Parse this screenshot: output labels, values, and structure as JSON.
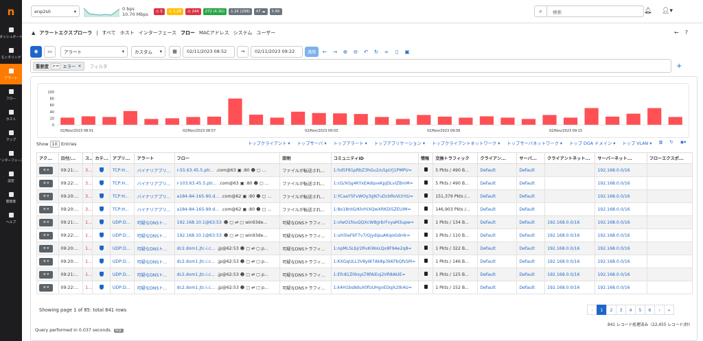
{
  "sidebar": {
    "logo": "n",
    "items": [
      {
        "label": "ダッシュボード",
        "icon": "gauge-icon"
      },
      {
        "label": "モニタリング",
        "icon": "pulse-icon"
      },
      {
        "label": "アラート",
        "icon": "warning-icon",
        "active": true
      },
      {
        "label": "フロー",
        "icon": "bars-icon"
      },
      {
        "label": "ホスト",
        "icon": "laptop-icon"
      },
      {
        "label": "マップ",
        "icon": "map-icon"
      },
      {
        "label": "インターフェース",
        "icon": "ethernet-icon"
      },
      {
        "label": "設定",
        "icon": "gear-icon"
      },
      {
        "label": "開発者",
        "icon": "code-icon"
      },
      {
        "label": "ヘルプ",
        "icon": "help-icon"
      }
    ]
  },
  "topbar": {
    "interface": "enp2s0",
    "rate_top": "0 bps",
    "rate_bottom": "10.70 Mbps",
    "badges": [
      {
        "text": "⚠ 5",
        "color": "#dc3545"
      },
      {
        "text": "⚠ 1.2K",
        "color": "#ffc107"
      },
      {
        "text": "⚠ 244",
        "color": "#dc3545"
      },
      {
        "text": "272 (4.3G)",
        "color": "#28a745"
      },
      {
        "text": "1.2K (298)",
        "color": "#6c757d"
      },
      {
        "text": "47 ☁",
        "color": "#6c757d"
      },
      {
        "text": "5.6K",
        "color": "#6c757d"
      }
    ],
    "search_placeholder": "検索"
  },
  "breadcrumbs": {
    "title": "アラートエクスプローラ",
    "items": [
      "すべて",
      "ホスト",
      "インターフェース",
      "フロー",
      "MACアドレス",
      "システム",
      "ユーザー"
    ],
    "selected": "フロー"
  },
  "filters": {
    "type": "アラート",
    "range": "カスタム",
    "start": "02/11/2023 08:52",
    "end": "02/11/2023 09:22",
    "apply": "適用"
  },
  "query": {
    "tag_key": "重要度",
    "tag_op": ">=",
    "tag_val": "エラー",
    "placeholder": "フィルタ"
  },
  "chart_data": {
    "type": "bar",
    "ylim": [
      0,
      100
    ],
    "yticks": [
      0,
      20,
      40,
      60,
      80,
      100
    ],
    "values": [
      22,
      26,
      24,
      42,
      18,
      20,
      24,
      25,
      80,
      31,
      22,
      40,
      36,
      35,
      33,
      24,
      18,
      30,
      25,
      22,
      26,
      22,
      18,
      30,
      22,
      51,
      25,
      34,
      51,
      24
    ],
    "xlabels": [
      "02/Nov/2023 08:51",
      "02/Nov/2023 08:57",
      "02/Nov/2023 09:03",
      "02/Nov/2023 09:09",
      "02/Nov/2023 09:15"
    ],
    "color": "#fe5055"
  },
  "table": {
    "show_label": "Show",
    "page_size": "10",
    "entries": "Entries",
    "dropdowns": [
      "トップクライアント",
      "トップサーバ",
      "トップアラート",
      "トップアプリケーション",
      "トップクライアントネットワーク",
      "トップサーバネットワーク",
      "トップ DGA ドメイン",
      "トップ VLAN"
    ],
    "columns": [
      "アク...",
      "日付/...",
      "ス...",
      "カテ...",
      "アプリ...",
      "アラート",
      "フロー",
      "説明",
      "コミュニティID",
      "情報",
      "交換トラフィック",
      "クライアン...",
      "サーバ...",
      "クライアントネット...",
      "サーバーネット...",
      "フローエクスポ..."
    ],
    "rows": [
      {
        "date": "09:21:...",
        "score": "3...",
        "app": "TCP:H...",
        "alert": "バイナリアプリ...",
        "flow": "r-55.63.45.5.ptr...",
        "flowb": ".com@63 ▣ :80 ☻ ▢ ...",
        "desc": "ファイルが転送され...",
        "cid": "1:hd5F81pRbZ3hGu2/u5pLYj1PMPU=",
        "traffic": "5 Pkts / 490 B...",
        "cli": "Default",
        "srv": "Default",
        "cnet": "",
        "snet": "192.168.0.0/16"
      },
      {
        "date": "09:22:...",
        "score": "3...",
        "app": "TCP:H...",
        "alert": "バイナリアプリ...",
        "flow": "r-103.63.45.5.ptr...",
        "flowb": ".com@63 ▣ :80 ☻ ▢ ...",
        "desc": "ファイルが転送され...",
        "cid": "1:cG/XGg4KYxEAdqveKpJDLvIZBmM=",
        "traffic": "5 Pkts / 490 B...",
        "cli": "Default",
        "srv": "Default",
        "cnet": "",
        "snet": "192.168.0.0/16"
      },
      {
        "date": "09:20:...",
        "score": "3...",
        "app": "TCP:H...",
        "alert": "バイナリアプリ...",
        "flow": "a184-84-165-90.d...",
        "flowb": ".com@62 ▣ :80 ☻ ▢ ...",
        "desc": "ファイルが転送され...",
        "cid": "1:YCaaY5FvWOy3gN7uDcbRoVLYrtU=",
        "traffic": "151,379 Pkts /...",
        "cli": "Default",
        "srv": "Default",
        "cnet": "",
        "snet": "192.168.0.0/16"
      },
      {
        "date": "09:20:...",
        "score": "3...",
        "app": "TCP:H...",
        "alert": "バイナリアプリ...",
        "flow": "a184-84-165-99.d...",
        "flowb": ".com@62 ▣ :80 ☻ ▢ ...",
        "desc": "ファイルが転送され...",
        "cid": "1:8o18ntG/KhrhiXQwXRKDi5ZEUIM=",
        "traffic": "146,903 Pkts /...",
        "cli": "Default",
        "srv": "Default",
        "cnet": "",
        "snet": "192.168.0.0/16"
      },
      {
        "date": "09:21:...",
        "score": "1...",
        "app": "UDP:D...",
        "alert": "可疑なDNSト...",
        "flow": "192.168.10.1@63:53",
        "flowb": "☻ ▢ ⇄ ▢ win93de...",
        "desc": "可疑なDNSトラフィ...",
        "cid": "1:vlwO1fouQQXcW8grbrFvyaM3upw=",
        "traffic": "1 Pkts / 134 B...",
        "cli": "Default",
        "srv": "Default",
        "cnet": "192.168.0.0/16",
        "snet": "192.168.0.0/16"
      },
      {
        "date": "09:22:...",
        "score": "1...",
        "app": "UDP:D...",
        "alert": "可疑なDNSト...",
        "flow": "192.168.10.1@63:53",
        "flowb": "☻ ▢ ⇄ ▢ win93de...",
        "desc": "可疑なDNSトラフィ...",
        "cid": "1:uH3IaFbF7v7/GjydipuAKqoGdmk=",
        "traffic": "1 Pkts / 110 B...",
        "cli": "Default",
        "srv": "Default",
        "cnet": "192.168.0.0/16",
        "snet": "192.168.0.0/16"
      },
      {
        "date": "09:20:...",
        "score": "1...",
        "app": "UDP:D...",
        "alert": "可疑なDNSト...",
        "flow": "dc2.dom1.jtc-i.c...",
        "flowb": ".jp@62:53 ☻ ▢ ⇄ ▢ p...",
        "desc": "可疑なDNSトラフィ...",
        "cid": "1:npMLSLbjr2RvKiWxLQx8F9Ae2q8=",
        "traffic": "1 Pkts / 322 B...",
        "cli": "Default",
        "srv": "Default",
        "cnet": "192.168.0.0/16",
        "snet": "192.168.0.0/16"
      },
      {
        "date": "09:20:...",
        "score": "1...",
        "app": "UDP:D...",
        "alert": "可疑なDNSト...",
        "flow": "dc2.dom1.jtc-i.c...",
        "flowb": ".jp@62:53 ☻ ▢ ⇄ ▢ p...",
        "desc": "可疑なDNSトラフィ...",
        "cid": "1:KXGqULL3V8yW7Ak8p3kKFbQfs5M=",
        "traffic": "1 Pkts / 146 B...",
        "cli": "Default",
        "srv": "Default",
        "cnet": "192.168.0.0/16",
        "snet": "192.168.0.0/16"
      },
      {
        "date": "09:21:...",
        "score": "1...",
        "app": "UDP:D...",
        "alert": "可疑なDNSト...",
        "flow": "dc2.dom1.jtc-i.c...",
        "flowb": ".jp@62:53 ☻ ▢ ⇄ ▢ p...",
        "desc": "可疑なDNSトラフィ...",
        "cid": "1:Efc81Z0ksyLT8fAiEoj2VR8AkIE=",
        "traffic": "1 Pkts / 125 B...",
        "cli": "Default",
        "srv": "Default",
        "cnet": "192.168.0.0/16",
        "snet": "192.168.0.0/16"
      },
      {
        "date": "09:22:...",
        "score": "1...",
        "app": "UDP:D...",
        "alert": "可疑なDNSト...",
        "flow": "dc2.dom1.jtc-i.c...",
        "flowb": ".jp@62:53 ☻ ▢ ⇄ ▢ p...",
        "desc": "可疑なDNSトラフィ...",
        "cid": "1:k4H1bs8duX0fUUHgvEDq/k2tk4U=",
        "traffic": "1 Pkts / 152 B...",
        "cli": "Default",
        "srv": "Default",
        "cnet": "192.168.0.0/16",
        "snet": "192.168.0.0/16"
      }
    ]
  },
  "pagination": {
    "info": "Showing page 1 of 85: total 841 rows",
    "pages": [
      "‹",
      "1",
      "2",
      "3",
      "4",
      "5",
      "6",
      "›",
      "»"
    ],
    "active": "1"
  },
  "stats": "841 レコード処理済み（22,455 レコード/秒）",
  "qtime": {
    "text": "Query performed in 0.037 seconds.",
    "badge": "SQL"
  }
}
